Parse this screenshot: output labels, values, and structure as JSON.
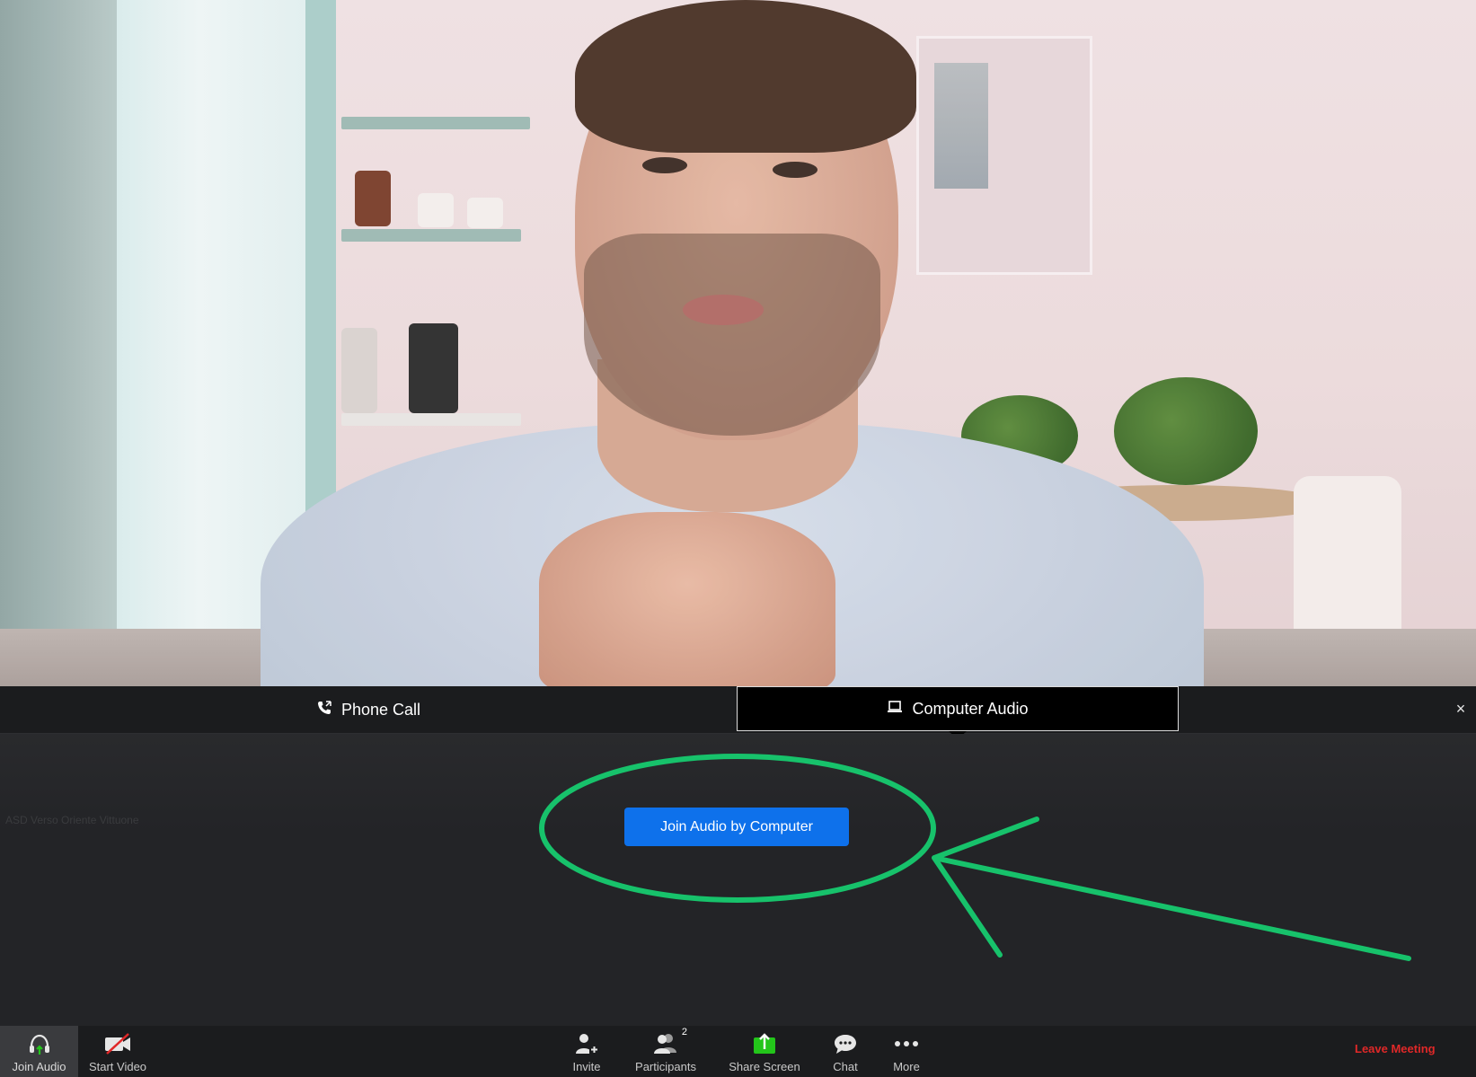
{
  "audio_tabs": {
    "phone_call": "Phone Call",
    "computer_audio": "Computer Audio"
  },
  "close_label": "×",
  "participant_name": "ASD Verso Oriente Vittuone",
  "join_audio_button": "Join Audio by Computer",
  "annotation_color": "#17c26b",
  "toolbar": {
    "join_audio": "Join Audio",
    "start_video": "Start Video",
    "invite": "Invite",
    "participants": "Participants",
    "participants_count": "2",
    "share_screen": "Share Screen",
    "chat": "Chat",
    "more": "More",
    "leave_meeting": "Leave Meeting"
  },
  "colors": {
    "primary_button": "#0e71eb",
    "leave": "#e02828",
    "share_icon": "#23c51a",
    "panel_bg": "#232427"
  }
}
